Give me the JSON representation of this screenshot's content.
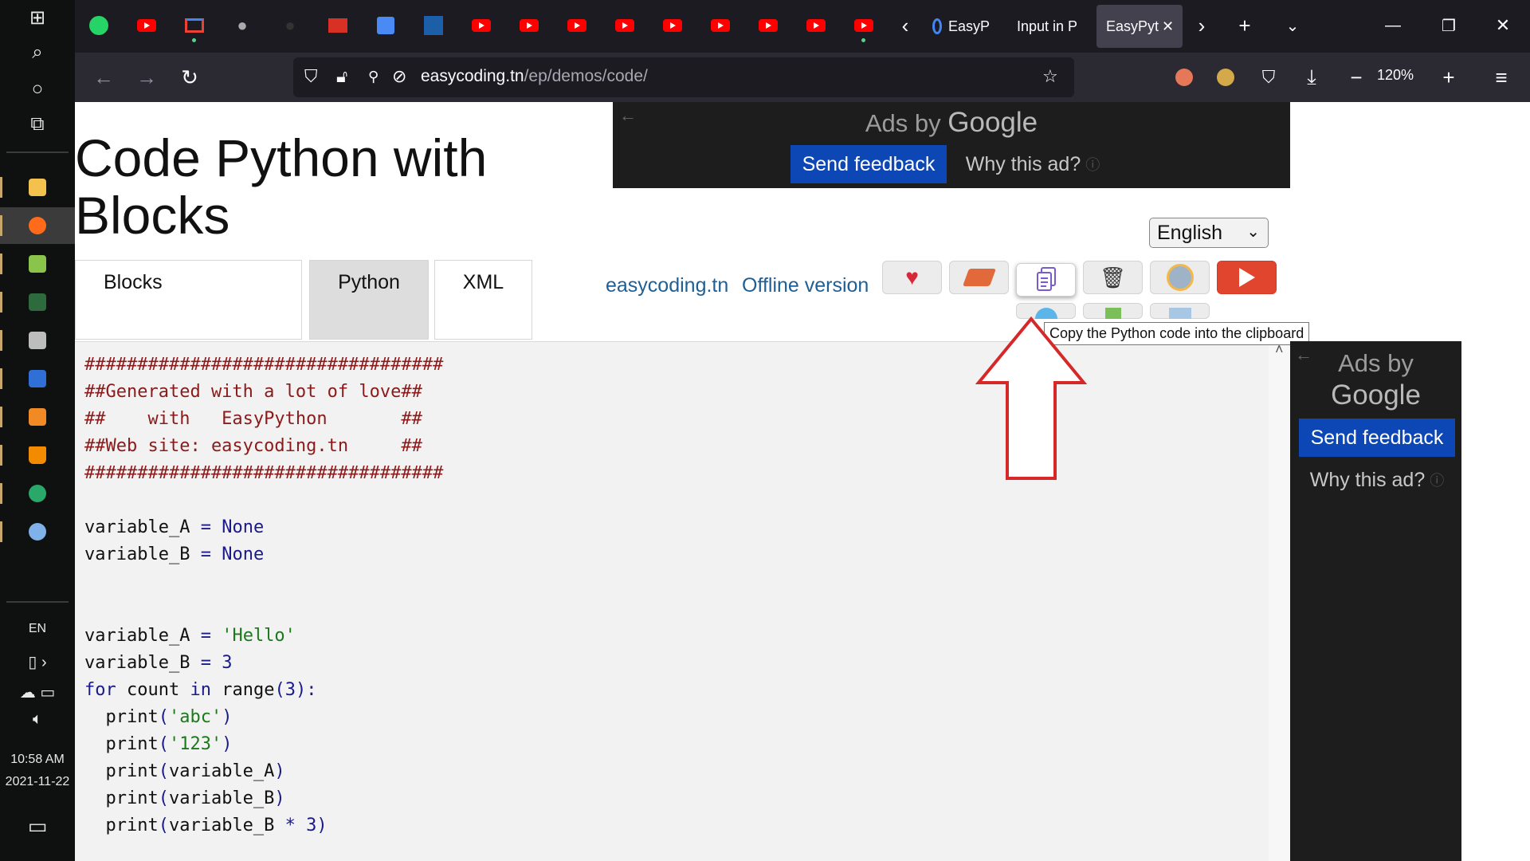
{
  "taskbar": {
    "language": "EN",
    "time": "10:58 AM",
    "date": "2021-11-22"
  },
  "browser": {
    "tabs": [
      {
        "label": "EasyP"
      },
      {
        "label": "Input in P"
      },
      {
        "label": "EasyPyt"
      }
    ],
    "url_domain": "easycoding.tn",
    "url_path": "/ep/demos/code/",
    "zoom": "120%"
  },
  "page": {
    "title": "Code Python with Blocks",
    "tabs": [
      "Blocks",
      "Python",
      "XML"
    ],
    "links": {
      "site": "easycoding.tn",
      "offline": "Offline version"
    },
    "language_select": "English",
    "tooltip": "Copy the Python code into the clipboard",
    "ads_top": {
      "ads_by": "Ads by",
      "brand": "Google",
      "send_feedback": "Send feedback",
      "why_ad": "Why this ad?"
    },
    "ads_side": {
      "ads_by": "Ads by",
      "brand": "Google",
      "send_feedback": "Send feedback",
      "why_ad": "Why this ad?"
    }
  },
  "code_lines": [
    "##################################",
    "##Generated with a lot of love##",
    "##    with   EasyPython       ##",
    "##Web site: easycoding.tn     ##",
    "##################################",
    "",
    "variable_A = None",
    "variable_B = None",
    "",
    "",
    "variable_A = 'Hello'",
    "variable_B = 3",
    "for count in range(3):",
    "  print('abc')",
    "  print('123')",
    "  print(variable_A)",
    "  print(variable_B)",
    "  print(variable_B * 3)"
  ],
  "colors": {
    "accent_red": "#e2452e",
    "link_blue": "#1f5f95",
    "ad_blue": "#0d47b5",
    "annotation_red": "#d62828"
  }
}
